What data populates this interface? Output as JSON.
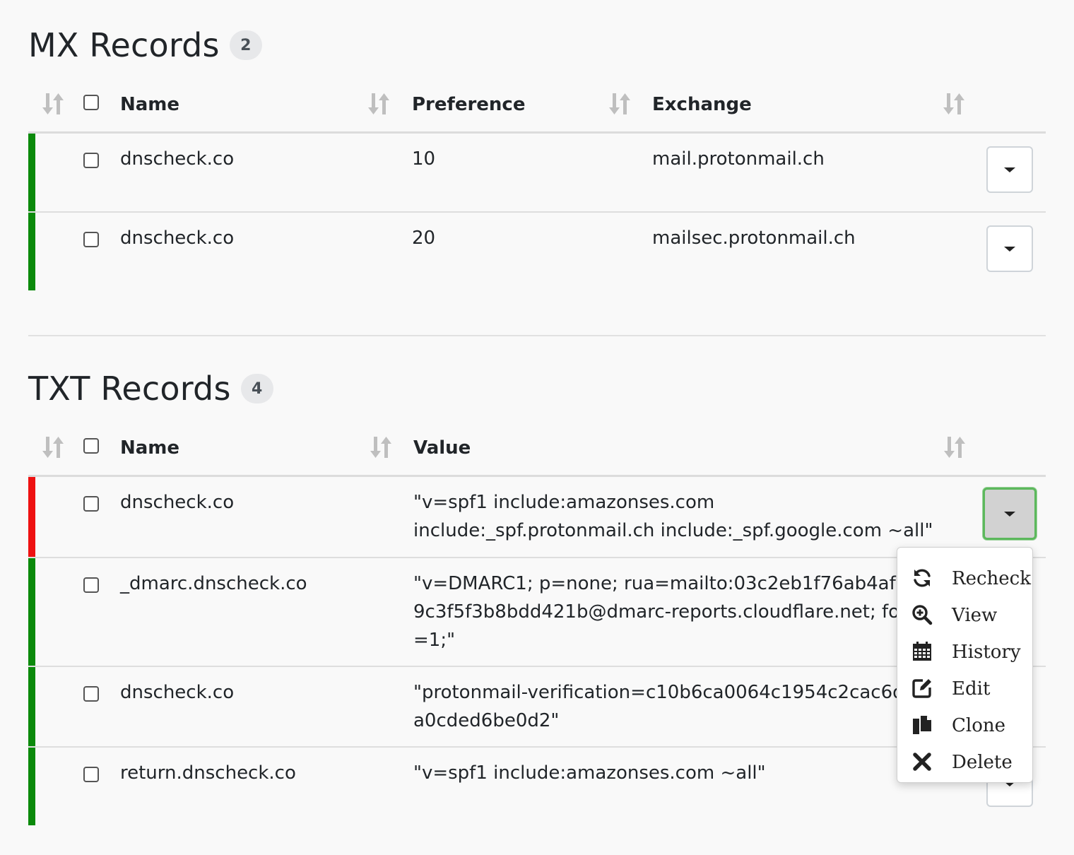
{
  "mx": {
    "title": "MX Records",
    "count": "2",
    "columns": {
      "name": "Name",
      "preference": "Preference",
      "exchange": "Exchange"
    },
    "rows": [
      {
        "name": "dnscheck.co",
        "preference": "10",
        "exchange": "mail.protonmail.ch",
        "status_color": "#0b8a0b"
      },
      {
        "name": "dnscheck.co",
        "preference": "20",
        "exchange": "mailsec.protonmail.ch",
        "status_color": "#0b8a0b"
      }
    ]
  },
  "txt": {
    "title": "TXT Records",
    "count": "4",
    "columns": {
      "name": "Name",
      "value": "Value"
    },
    "rows": [
      {
        "name": "dnscheck.co",
        "value": "\"v=spf1 include:amazonses.com include:_spf.protonmail.ch include:_spf.google.com ~all\"",
        "status_color": "#ee1111"
      },
      {
        "name": "_dmarc.dnscheck.co",
        "value": "\"v=DMARC1; p=none; rua=mailto:03c2eb1f76ab4af79c3f5f3b8bdd421b@dmarc-reports.cloudflare.net; fo=1;\"",
        "status_color": "#0b8a0b"
      },
      {
        "name": "dnscheck.co",
        "value": "\"protonmail-verification=c10b6ca0064c1954c2cac6da0cded6be0d2\"",
        "status_color": "#0b8a0b"
      },
      {
        "name": "return.dnscheck.co",
        "value": "\"v=spf1 include:amazonses.com ~all\"",
        "status_color": "#0b8a0b"
      }
    ]
  },
  "menu": {
    "items": [
      {
        "label": "Recheck",
        "icon": "refresh-icon"
      },
      {
        "label": "View",
        "icon": "zoom-icon"
      },
      {
        "label": "History",
        "icon": "calendar-icon"
      },
      {
        "label": "Edit",
        "icon": "edit-icon"
      },
      {
        "label": "Clone",
        "icon": "copy-icon"
      },
      {
        "label": "Delete",
        "icon": "close-icon"
      }
    ]
  }
}
